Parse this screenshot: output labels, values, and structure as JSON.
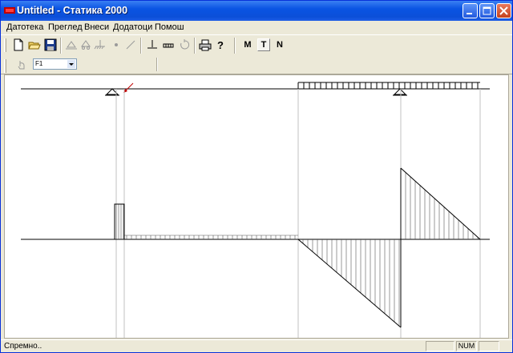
{
  "window": {
    "title": "Untitled - Статика 2000"
  },
  "menu": {
    "items": [
      "Датотека",
      "Преглед",
      "Внеси",
      "Додатоци",
      "Помош"
    ]
  },
  "toolbar": {
    "icons": [
      "new-file-icon",
      "open-folder-icon",
      "save-disk-icon",
      "support-pin-icon",
      "support-roller-icon",
      "support-fixed-icon",
      "node-icon",
      "bar-icon",
      "point-load-icon",
      "distributed-load-icon",
      "moment-load-icon",
      "print-icon",
      "help-icon"
    ],
    "diagram_modes": [
      "M",
      "T",
      "N"
    ],
    "active_mode": "T"
  },
  "toolbar2": {
    "load_case_value": "F1"
  },
  "status": {
    "text": "Спремно..",
    "num": "NUM"
  },
  "colors": {
    "titlebar": "#0a54e3",
    "canvas": "#ffffff",
    "diagram_line": "#000000",
    "hatch": "#000000"
  }
}
